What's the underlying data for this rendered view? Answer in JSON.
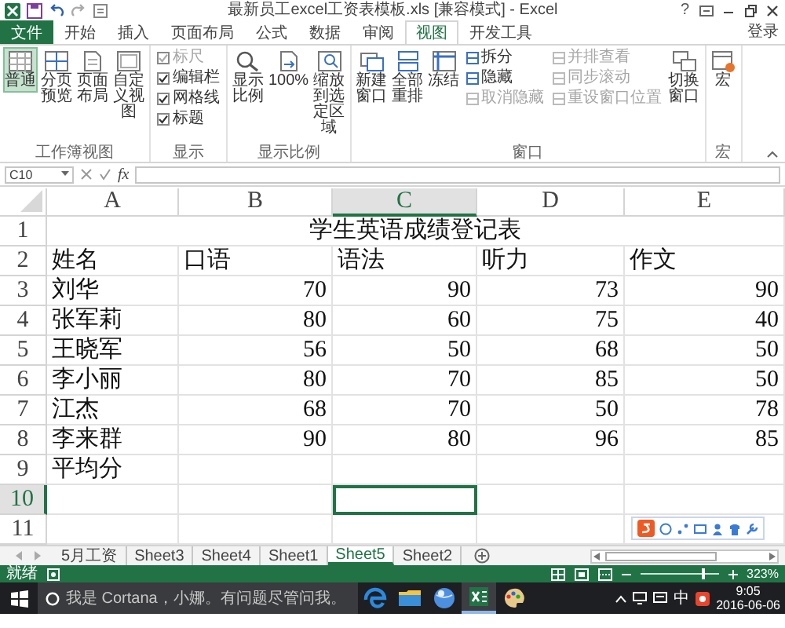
{
  "window": {
    "title": "最新员工excel工资表模板.xls  [兼容模式] - Excel",
    "help": "?"
  },
  "ribbon_tabs": [
    {
      "label": "文件",
      "kind": "file",
      "selected": false
    },
    {
      "label": "开始",
      "kind": "tab",
      "selected": false
    },
    {
      "label": "插入",
      "kind": "tab",
      "selected": false
    },
    {
      "label": "页面布局",
      "kind": "tab",
      "selected": false
    },
    {
      "label": "公式",
      "kind": "tab",
      "selected": false
    },
    {
      "label": "数据",
      "kind": "tab",
      "selected": false
    },
    {
      "label": "审阅",
      "kind": "tab",
      "selected": false
    },
    {
      "label": "视图",
      "kind": "tab",
      "selected": true
    },
    {
      "label": "开发工具",
      "kind": "tab",
      "selected": false
    }
  ],
  "account": "登录",
  "ribbon_groups": [
    {
      "label": "工作簿视图",
      "items": [
        {
          "kind": "large",
          "label": "普通",
          "selected": true
        },
        {
          "kind": "large",
          "label": "分页预览",
          "selected": false
        },
        {
          "kind": "large",
          "label": "页面布局",
          "selected": false
        },
        {
          "kind": "large",
          "label": "自定义视图",
          "selected": false
        }
      ]
    },
    {
      "label": "显示",
      "items": [
        {
          "kind": "check",
          "label": "标尺",
          "checked": true,
          "disabled": true
        },
        {
          "kind": "check",
          "label": "编辑栏",
          "checked": true,
          "disabled": false
        },
        {
          "kind": "check",
          "label": "网格线",
          "checked": true,
          "disabled": false
        },
        {
          "kind": "check",
          "label": "标题",
          "checked": true,
          "disabled": false
        }
      ]
    },
    {
      "label": "显示比例",
      "items": [
        {
          "kind": "large",
          "label": "显示比例",
          "selected": false
        },
        {
          "kind": "large",
          "label": "100%",
          "selected": false
        },
        {
          "kind": "large",
          "label": "缩放到选定区域",
          "selected": false
        }
      ]
    },
    {
      "label": "窗口",
      "items": [
        {
          "kind": "large",
          "label": "新建窗口",
          "selected": false
        },
        {
          "kind": "large",
          "label": "全部重排",
          "selected": false
        },
        {
          "kind": "large",
          "label": "冻结",
          "selected": false
        },
        {
          "kind": "small",
          "label": "拆分",
          "disabled": false
        },
        {
          "kind": "small",
          "label": "隐藏",
          "disabled": false
        },
        {
          "kind": "small",
          "label": "取消隐藏",
          "disabled": true
        },
        {
          "kind": "small",
          "label": "并排查看",
          "disabled": true
        },
        {
          "kind": "small",
          "label": "同步滚动",
          "disabled": true
        },
        {
          "kind": "small",
          "label": "重设窗口位置",
          "disabled": true
        },
        {
          "kind": "large",
          "label": "切换窗口",
          "selected": false
        }
      ]
    },
    {
      "label": "宏",
      "items": [
        {
          "kind": "large",
          "label": "宏",
          "selected": false
        }
      ]
    }
  ],
  "formula_bar": {
    "name_box": "C10",
    "fx": "fx"
  },
  "sheet": {
    "columns": [
      {
        "label": "A",
        "selected": false
      },
      {
        "label": "B",
        "selected": false
      },
      {
        "label": "C",
        "selected": true
      },
      {
        "label": "D",
        "selected": false
      },
      {
        "label": "E",
        "selected": false
      }
    ],
    "rows": [
      {
        "label": "1",
        "selected": false,
        "cells": [
          {
            "kind": "title",
            "text": "学生英语成绩登记表",
            "colspan": 5
          }
        ]
      },
      {
        "label": "2",
        "selected": false,
        "cells": [
          {
            "kind": "text",
            "text": "姓名"
          },
          {
            "kind": "text",
            "text": "口语"
          },
          {
            "kind": "text",
            "text": "语法"
          },
          {
            "kind": "text",
            "text": "听力"
          },
          {
            "kind": "text",
            "text": "作文"
          }
        ]
      },
      {
        "label": "3",
        "selected": false,
        "cells": [
          {
            "kind": "text",
            "text": "刘华"
          },
          {
            "kind": "number",
            "text": "70"
          },
          {
            "kind": "number",
            "text": "90"
          },
          {
            "kind": "number",
            "text": "73"
          },
          {
            "kind": "number",
            "text": "90"
          }
        ]
      },
      {
        "label": "4",
        "selected": false,
        "cells": [
          {
            "kind": "text",
            "text": "张军莉"
          },
          {
            "kind": "number",
            "text": "80"
          },
          {
            "kind": "number",
            "text": "60"
          },
          {
            "kind": "number",
            "text": "75"
          },
          {
            "kind": "number",
            "text": "40"
          }
        ]
      },
      {
        "label": "5",
        "selected": false,
        "cells": [
          {
            "kind": "text",
            "text": "王晓军"
          },
          {
            "kind": "number",
            "text": "56"
          },
          {
            "kind": "number",
            "text": "50"
          },
          {
            "kind": "number",
            "text": "68"
          },
          {
            "kind": "number",
            "text": "50"
          }
        ]
      },
      {
        "label": "6",
        "selected": false,
        "cells": [
          {
            "kind": "text",
            "text": "李小丽"
          },
          {
            "kind": "number",
            "text": "80"
          },
          {
            "kind": "number",
            "text": "70"
          },
          {
            "kind": "number",
            "text": "85"
          },
          {
            "kind": "number",
            "text": "50"
          }
        ]
      },
      {
        "label": "7",
        "selected": false,
        "cells": [
          {
            "kind": "text",
            "text": "江杰"
          },
          {
            "kind": "number",
            "text": "68"
          },
          {
            "kind": "number",
            "text": "70"
          },
          {
            "kind": "number",
            "text": "50"
          },
          {
            "kind": "number",
            "text": "78"
          }
        ]
      },
      {
        "label": "8",
        "selected": false,
        "cells": [
          {
            "kind": "text",
            "text": "李来群"
          },
          {
            "kind": "number",
            "text": "90"
          },
          {
            "kind": "number",
            "text": "80"
          },
          {
            "kind": "number",
            "text": "96"
          },
          {
            "kind": "number",
            "text": "85"
          }
        ]
      },
      {
        "label": "9",
        "selected": false,
        "cells": [
          {
            "kind": "text",
            "text": "平均分"
          }
        ]
      },
      {
        "label": "10",
        "selected": true,
        "cells": []
      },
      {
        "label": "11",
        "selected": false,
        "cells": []
      }
    ]
  },
  "sheet_tabs": [
    {
      "label": "5月工资",
      "selected": false
    },
    {
      "label": "Sheet3",
      "selected": false
    },
    {
      "label": "Sheet4",
      "selected": false
    },
    {
      "label": "Sheet1",
      "selected": false
    },
    {
      "label": "Sheet5",
      "selected": true
    },
    {
      "label": "Sheet2",
      "selected": false
    }
  ],
  "status_bar": {
    "status": "就绪",
    "zoom": {
      "level": 0.8,
      "reading": "323%"
    }
  },
  "taskbar": {
    "search": {
      "placeholder": "我是 Cortana，小娜。有问题尽管问我。"
    },
    "apps": [
      {
        "kind": "edge",
        "selected": false
      },
      {
        "kind": "folder",
        "selected": false
      },
      {
        "kind": "globe",
        "selected": false
      },
      {
        "kind": "excel",
        "selected": true
      },
      {
        "kind": "paint",
        "selected": false
      }
    ],
    "input_method": "中",
    "time": "9:05",
    "date": "2016-06-06"
  }
}
